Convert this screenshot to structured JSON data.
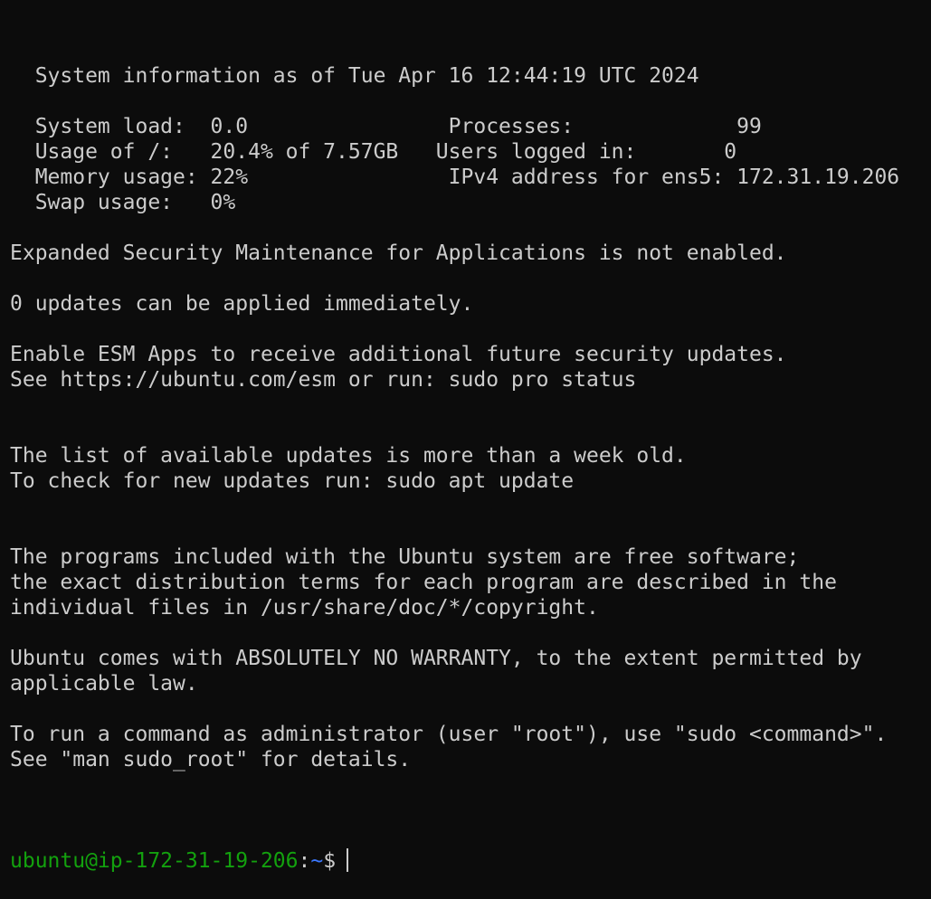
{
  "terminal": {
    "lines": [
      "  System information as of Tue Apr 16 12:44:19 UTC 2024",
      "",
      "  System load:  0.0                Processes:             99",
      "  Usage of /:   20.4% of 7.57GB   Users logged in:       0",
      "  Memory usage: 22%                IPv4 address for ens5: 172.31.19.206",
      "  Swap usage:   0%",
      "",
      "Expanded Security Maintenance for Applications is not enabled.",
      "",
      "0 updates can be applied immediately.",
      "",
      "Enable ESM Apps to receive additional future security updates.",
      "See https://ubuntu.com/esm or run: sudo pro status",
      "",
      "",
      "The list of available updates is more than a week old.",
      "To check for new updates run: sudo apt update",
      "",
      "",
      "The programs included with the Ubuntu system are free software;",
      "the exact distribution terms for each program are described in the",
      "individual files in /usr/share/doc/*/copyright.",
      "",
      "Ubuntu comes with ABSOLUTELY NO WARRANTY, to the extent permitted by",
      "applicable law.",
      "",
      "To run a command as administrator (user \"root\"), use \"sudo <command>\".",
      "See \"man sudo_root\" for details.",
      ""
    ],
    "prompt": {
      "user_host": "ubuntu@ip-172-31-19-206",
      "colon": ":",
      "path": "~",
      "symbol": "$"
    }
  },
  "colors": {
    "background": "#0c0c0c",
    "foreground": "#cccccc",
    "prompt_user": "#13a10e",
    "prompt_path": "#3b78ff"
  }
}
